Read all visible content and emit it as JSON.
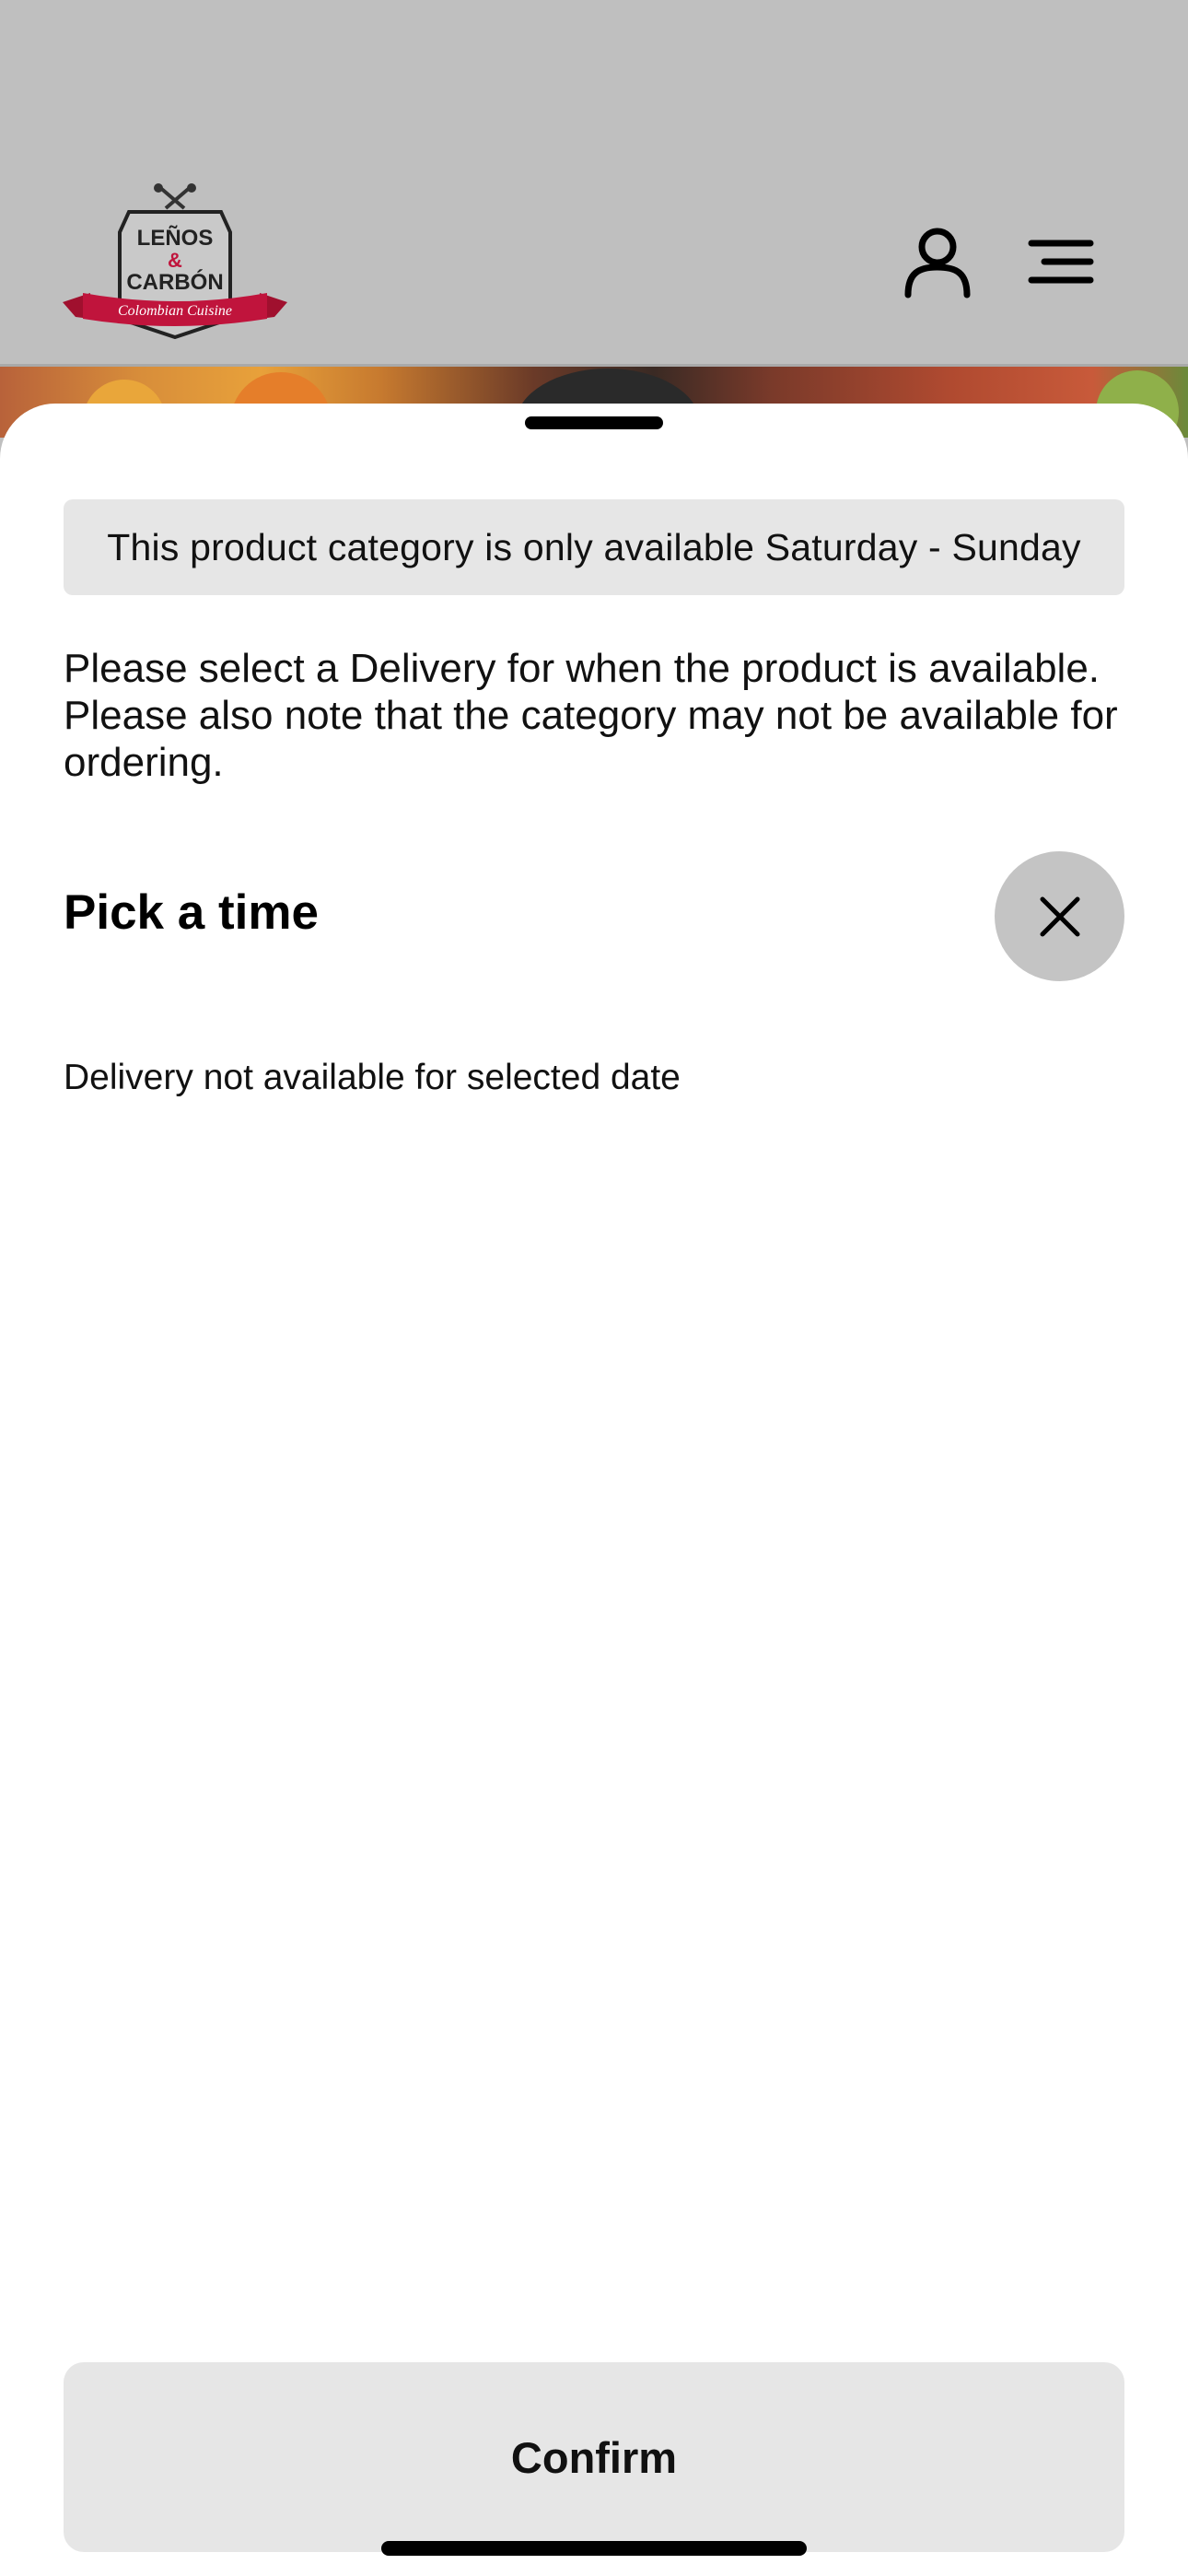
{
  "header": {
    "logo_text": {
      "line1": "LEÑOS",
      "line2": "&",
      "line3": "CARBÓN",
      "ribbon": "Colombian Cuisine"
    },
    "icons": [
      "account-icon",
      "menu-icon"
    ]
  },
  "sheet": {
    "notice": "This product category is only available Saturday - Sunday",
    "description": "Please select a Delivery for when the product is available. Please also note that the category may not be available for ordering.",
    "pick_title": "Pick a time",
    "status": "Delivery not available for selected date",
    "confirm_label": "Confirm"
  },
  "colors": {
    "header_bg": "#bfbfbf",
    "brand_red": "#c0143c",
    "notice_bg": "#e6e6e6",
    "close_bg": "#c4c4c4"
  }
}
